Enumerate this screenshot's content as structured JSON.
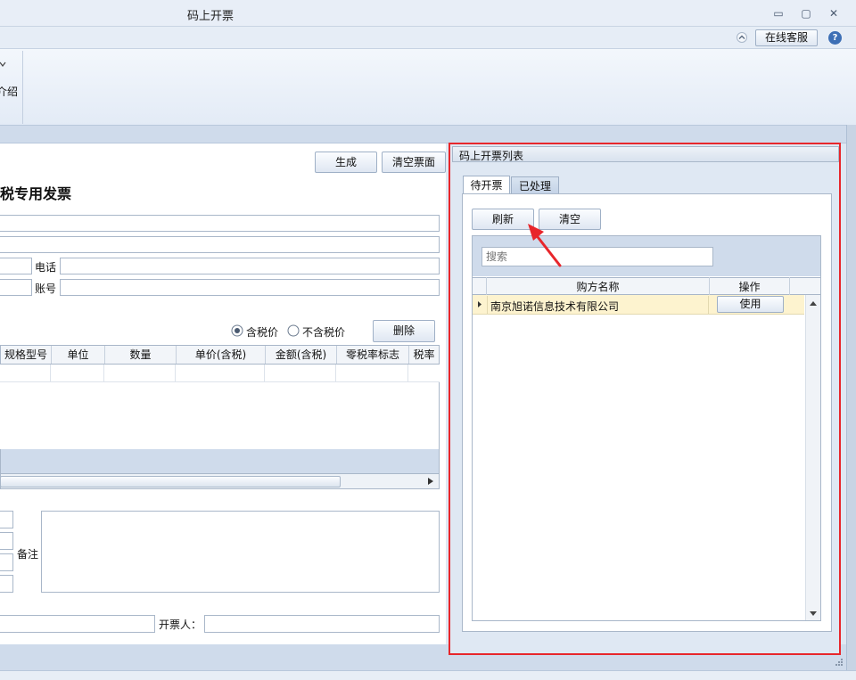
{
  "window": {
    "title": "码上开票",
    "minimize_glyph": "▭",
    "restore_glyph": "▢",
    "close_glyph": "✕"
  },
  "menubar": {
    "collapse_icon": "chevron-up-icon",
    "service_label": "在线客服",
    "help_glyph": "?"
  },
  "ribbon": {
    "partial_label": "介绍"
  },
  "left": {
    "generate_label": "生成",
    "clear_face_label": "清空票面",
    "invoice_title": "税专用发票",
    "phone_label": "电话",
    "account_label": "账号",
    "tax_incl_label": "含税价",
    "tax_excl_label": "不含税价",
    "tax_incl_selected": true,
    "delete_label": "删除",
    "columns": [
      "规格型号",
      "单位",
      "数量",
      "单价(含税)",
      "金额(含税)",
      "零税率标志",
      "税率"
    ],
    "remark_label": "备注",
    "drawer_label": "开票人："
  },
  "right": {
    "panel_title": "码上开票列表",
    "tabs": [
      "待开票",
      "已处理"
    ],
    "active_tab": 0,
    "refresh_label": "刷新",
    "clear_label": "清空",
    "search_placeholder": "搜索",
    "columns": [
      "购方名称",
      "操作"
    ],
    "rows": [
      {
        "buyer": "南京旭诺信息技术有限公司",
        "action": "使用"
      }
    ]
  },
  "colors": {
    "highlight": "#e8262b",
    "row_selected": "#fdf3cf",
    "window_bg": "#dfe8f3"
  }
}
